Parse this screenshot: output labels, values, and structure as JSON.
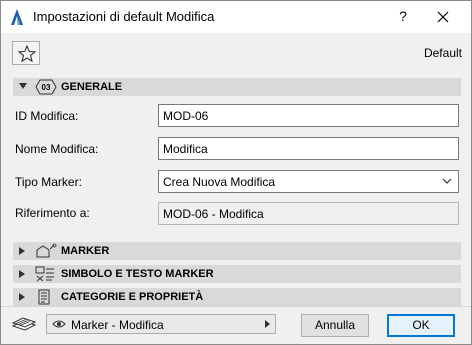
{
  "window": {
    "title": "Impostazioni di default Modifica",
    "help": "?"
  },
  "toolbar": {
    "default_label": "Default"
  },
  "sections": {
    "generale": {
      "label": "GENERALE",
      "badge": "03"
    },
    "marker": {
      "label": "MARKER"
    },
    "simbolo": {
      "label": "SIMBOLO E TESTO MARKER"
    },
    "categorie": {
      "label": "CATEGORIE E PROPRIETÀ"
    }
  },
  "form": {
    "id_label": "ID Modifica:",
    "id_value": "MOD-06",
    "nome_label": "Nome Modifica:",
    "nome_value": "Modifica",
    "tipo_label": "Tipo Marker:",
    "tipo_value": "Crea Nuova Modifica",
    "rif_label": "Riferimento a:",
    "rif_value": "MOD-06 - Modifica"
  },
  "footer": {
    "view_label": "Marker - Modifica",
    "cancel_label": "Annulla",
    "ok_label": "OK"
  }
}
